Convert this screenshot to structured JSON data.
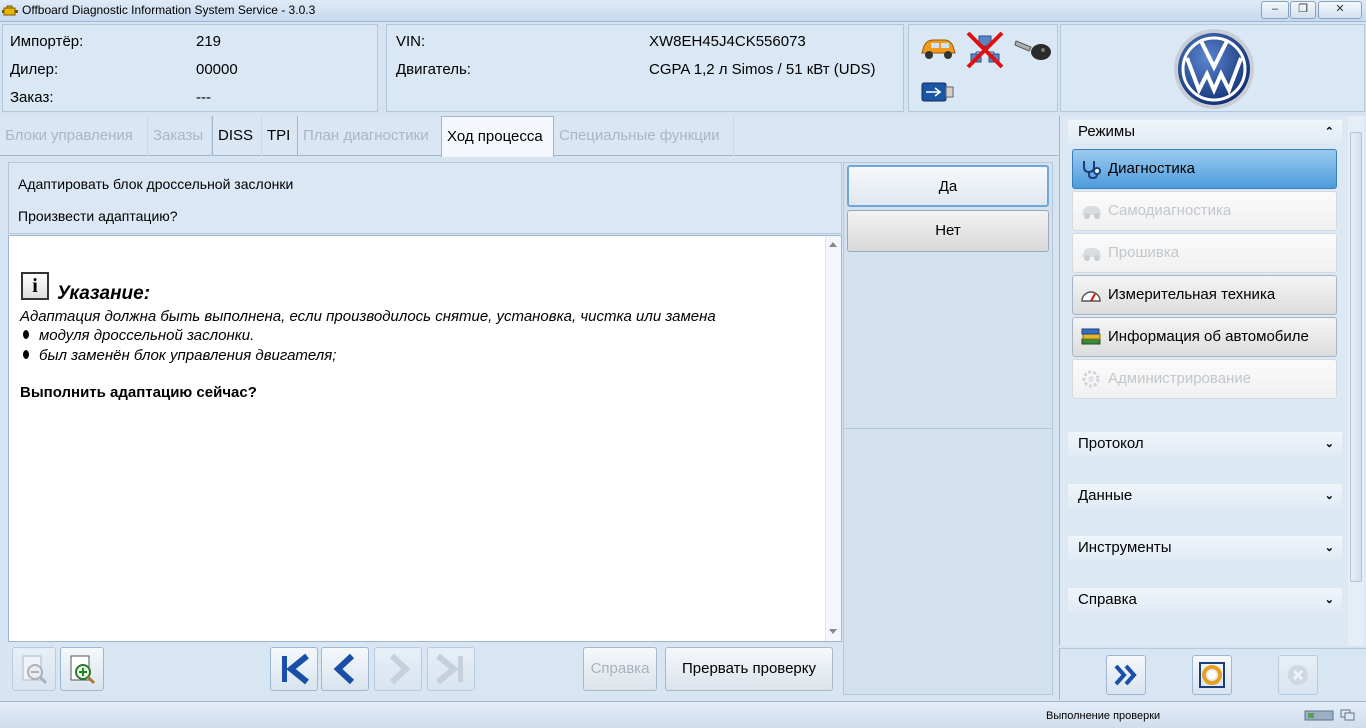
{
  "window": {
    "title": "Offboard Diagnostic Information System Service - 3.0.3",
    "minimize": "‒",
    "maximize": "❐",
    "close": "✕"
  },
  "dealer_info": {
    "importer_label": "Импортёр:",
    "importer_value": "219",
    "dealer_label": "Дилер:",
    "dealer_value": "00000",
    "order_label": "Заказ:",
    "order_value": "---"
  },
  "vehicle_info": {
    "vin_label": "VIN:",
    "vin_value": "XW8EH45J4CK556073",
    "engine_label": "Двигатель:",
    "engine_value": "CGPA 1,2 л Simos / 51 кВт (UDS)"
  },
  "status_icons": [
    "car-icon",
    "disconnected-network-icon",
    "ignition-key-icon",
    "usb-icon"
  ],
  "tabs": [
    {
      "label": "Блоки управления",
      "state": "disabled"
    },
    {
      "label": "Заказы",
      "state": "disabled"
    },
    {
      "label": "DISS",
      "state": "enabled"
    },
    {
      "label": "TPI",
      "state": "enabled"
    },
    {
      "label": "План диагностики",
      "state": "disabled"
    },
    {
      "label": "Ход процесса",
      "state": "active"
    },
    {
      "label": "Специальные функции",
      "state": "disabled"
    }
  ],
  "question": {
    "line1": "Адаптировать блок дроссельной заслонки",
    "line2": "Произвести адаптацию?"
  },
  "content": {
    "note_icon_glyph": "i",
    "note_title": "Указание:",
    "note_text": "Адаптация должна быть выполнена, если производилось снятие, установка, чистка или замена",
    "bullets": [
      "модуля дроссельной заслонки.",
      "был заменён блок управления двигателя;"
    ],
    "ask": "Выполнить адаптацию сейчас?"
  },
  "answers": {
    "yes": "Да",
    "no": "Нет"
  },
  "bottom_toolbar": {
    "help": "Справка",
    "abort": "Прервать проверку"
  },
  "sidebar": {
    "modes_header": "Режимы",
    "modes": [
      {
        "label": "Диагностика",
        "state": "active"
      },
      {
        "label": "Самодиагностика",
        "state": "disabled"
      },
      {
        "label": "Прошивка",
        "state": "disabled"
      },
      {
        "label": "Измерительная техника",
        "state": "enabled"
      },
      {
        "label": "Информация об автомобиле",
        "state": "enabled"
      },
      {
        "label": "Администрирование",
        "state": "disabled"
      }
    ],
    "sections": [
      "Протокол",
      "Данные",
      "Инструменты",
      "Справка"
    ]
  },
  "status": {
    "text": "Выполнение проверки"
  },
  "colors": {
    "accent": "#1a4fa8",
    "vw_blue": "#1b3f8f",
    "active_mode": "#4d9bdc"
  }
}
